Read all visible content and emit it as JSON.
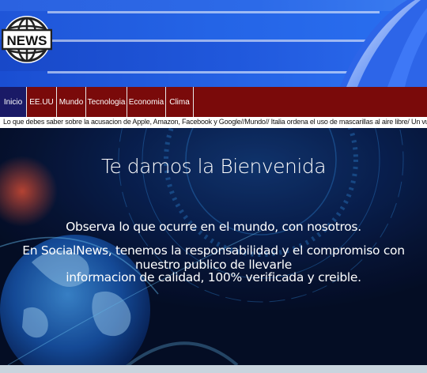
{
  "logo": {
    "text": "NEWS"
  },
  "nav": {
    "tabs": [
      {
        "label": "Inicio",
        "active": true
      },
      {
        "label": "EE.UU"
      },
      {
        "label": "Mundo"
      },
      {
        "label": "Tecnologia"
      },
      {
        "label": "Economia"
      },
      {
        "label": "Clima"
      }
    ]
  },
  "ticker": {
    "text": "Lo que debes saber sobre la acusacion de Apple, Amazon, Facebook y Google//Mundo// Italia ordena el uso de mascarillas al aire libre/ Un vuelo de vigilancia de EE.UU sobre el"
  },
  "hero": {
    "title": "Te damos la Bienvenida",
    "line1": "Observa lo que ocurre en el mundo, con nosotros.",
    "line2": "En SocialNews, tenemos la responsabilidad y el compromiso con nuestro publico de llevarle",
    "line3": "informacion de calidad, 100% verificada y creible."
  },
  "colors": {
    "nav_bg": "#7a0a0a",
    "nav_active": "#1a1a66",
    "header_blue": "#1f52d8"
  }
}
